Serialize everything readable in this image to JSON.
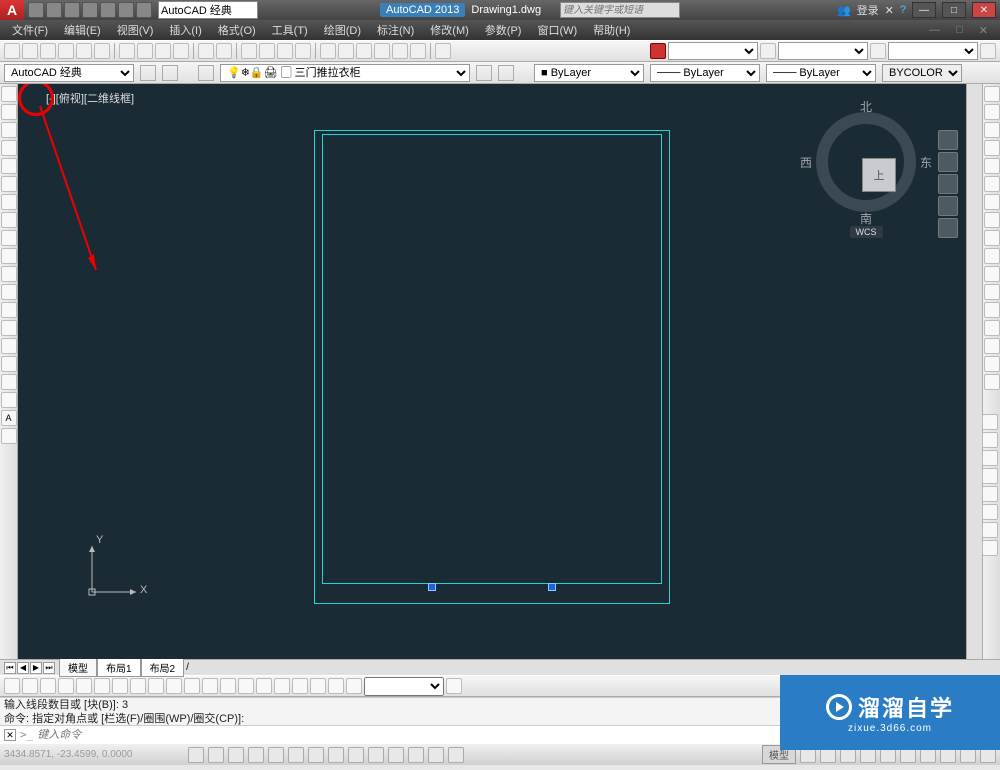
{
  "title": {
    "app": "AutoCAD 2013",
    "doc": "Drawing1.dwg",
    "search_placeholder": "键入关键字或短语",
    "login": "登录",
    "workspace": "AutoCAD 经典"
  },
  "menu": [
    "文件(F)",
    "编辑(E)",
    "视图(V)",
    "插入(I)",
    "格式(O)",
    "工具(T)",
    "绘图(D)",
    "标注(N)",
    "修改(M)",
    "参数(P)",
    "窗口(W)",
    "帮助(H)"
  ],
  "propbar": {
    "style": "AutoCAD 经典",
    "layer": "三门推拉衣柜",
    "bylayer1": "ByLayer",
    "bylayer2": "ByLayer",
    "bylayer3": "ByLayer",
    "bycolor": "BYCOLOR"
  },
  "canvas": {
    "view_label": "[-][俯视][二维线框]"
  },
  "viewcube": {
    "n": "北",
    "s": "南",
    "e": "东",
    "w": "西",
    "top": "上",
    "wcs": "WCS"
  },
  "ucs": {
    "x": "X",
    "y": "Y"
  },
  "tabs": {
    "model": "模型",
    "layout1": "布局1",
    "layout2": "布局2"
  },
  "cmdlog": {
    "l1": "输入线段数目或 [块(B)]: 3",
    "l2": "命令: 指定对角点或 [栏选(F)/圈围(WP)/圈交(CP)]:"
  },
  "cmdinput": {
    "placeholder": "键入命令",
    "prefix": ">_"
  },
  "status": {
    "coords": "3434.8571, -23.4599, 0.0000",
    "model": "模型"
  },
  "watermark": {
    "text": "溜溜自学",
    "url": "zixue.3d66.com"
  }
}
